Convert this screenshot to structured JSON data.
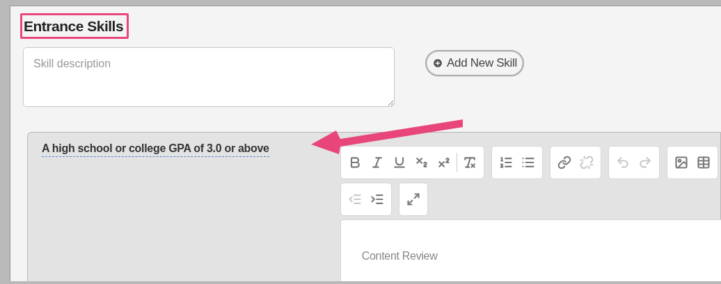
{
  "section": {
    "title": "Entrance Skills",
    "highlighted": true
  },
  "skill_input": {
    "placeholder": "Skill description"
  },
  "add_button": {
    "label": "Add New Skill"
  },
  "skill_card": {
    "title": "A high school or college GPA of 3.0 or above",
    "toolbar_rows": [
      [
        {
          "buttons": [
            {
              "kind": "bold",
              "disabled": false
            },
            {
              "kind": "italic",
              "disabled": false
            },
            {
              "kind": "underline",
              "disabled": false
            },
            {
              "kind": "subscript",
              "disabled": false
            },
            {
              "kind": "superscript",
              "disabled": false
            },
            {
              "kind": "separator"
            },
            {
              "kind": "clear-format",
              "disabled": false
            }
          ]
        },
        {
          "buttons": [
            {
              "kind": "numbered-list",
              "disabled": false
            },
            {
              "kind": "bullet-list",
              "disabled": false
            }
          ]
        },
        {
          "buttons": [
            {
              "kind": "link",
              "disabled": false
            },
            {
              "kind": "unlink",
              "disabled": true
            }
          ]
        },
        {
          "buttons": [
            {
              "kind": "undo",
              "disabled": true
            },
            {
              "kind": "redo",
              "disabled": true
            }
          ]
        },
        {
          "buttons": [
            {
              "kind": "image",
              "disabled": false
            },
            {
              "kind": "table",
              "disabled": false
            }
          ]
        }
      ],
      [
        {
          "buttons": [
            {
              "kind": "outdent",
              "disabled": true
            },
            {
              "kind": "indent",
              "disabled": false
            }
          ]
        },
        {
          "buttons": [
            {
              "kind": "maximize",
              "disabled": false
            }
          ]
        }
      ]
    ],
    "editor_text": "Content Review"
  }
}
